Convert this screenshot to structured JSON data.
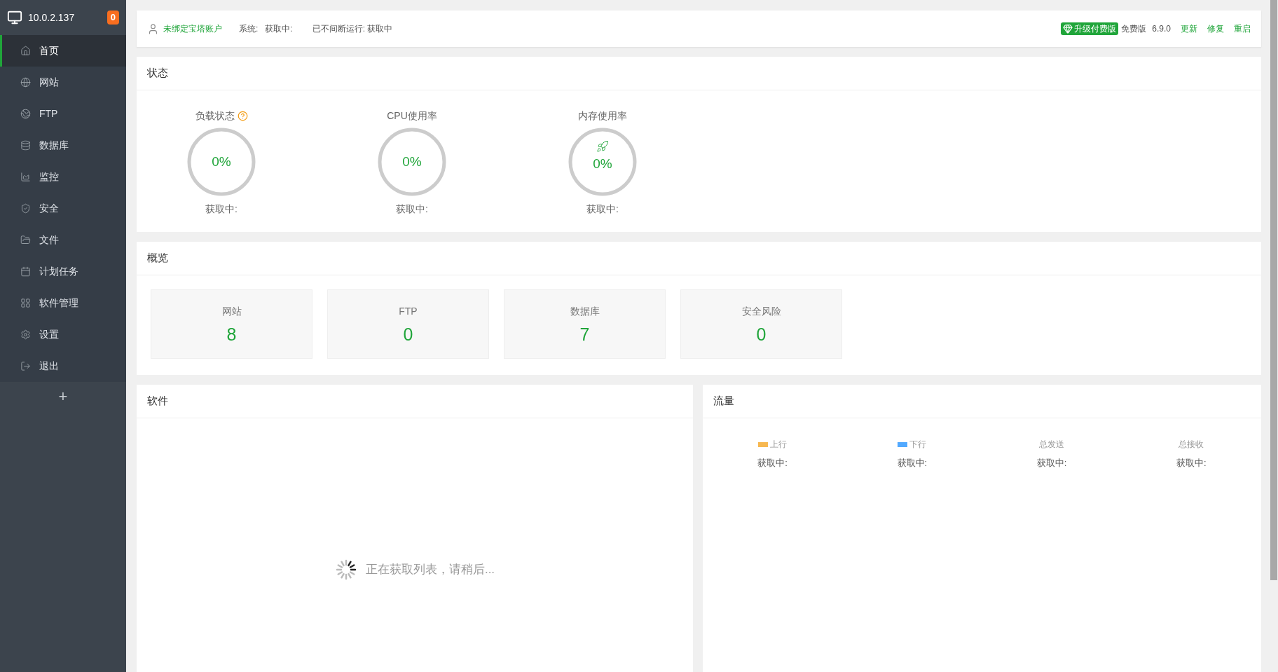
{
  "sidebar": {
    "host": "10.0.2.137",
    "badge": "0",
    "items": [
      {
        "label": "首页",
        "selected": true
      },
      {
        "label": "网站",
        "selected": false
      },
      {
        "label": "FTP",
        "selected": false
      },
      {
        "label": "数据库",
        "selected": false
      },
      {
        "label": "监控",
        "selected": false
      },
      {
        "label": "安全",
        "selected": false
      },
      {
        "label": "文件",
        "selected": false
      },
      {
        "label": "计划任务",
        "selected": false
      },
      {
        "label": "软件管理",
        "selected": false
      },
      {
        "label": "设置",
        "selected": false
      },
      {
        "label": "退出",
        "selected": false
      }
    ],
    "add": "+"
  },
  "top_bar": {
    "account": "未绑定宝塔账户",
    "system_label": "系统:",
    "system_value": "获取中:",
    "uptime": "已不间断运行: 获取中",
    "upgrade": "升级付费版",
    "edition": "免费版",
    "version": "6.9.0",
    "links": [
      "更新",
      "修复",
      "重启"
    ]
  },
  "status": {
    "title": "状态",
    "gauges": [
      {
        "label": "负载状态",
        "value": "0%",
        "caption": "获取中:"
      },
      {
        "label": "CPU使用率",
        "value": "0%",
        "caption": "获取中:"
      },
      {
        "label": "内存使用率",
        "value": "0%",
        "caption": "获取中:"
      }
    ]
  },
  "overview": {
    "title": "概览",
    "cards": [
      {
        "label": "网站",
        "value": "8"
      },
      {
        "label": "FTP",
        "value": "0"
      },
      {
        "label": "数据库",
        "value": "7"
      },
      {
        "label": "安全风险",
        "value": "0"
      }
    ]
  },
  "software": {
    "title": "软件",
    "loading": "正在获取列表，请稍后..."
  },
  "traffic": {
    "title": "流量",
    "columns": [
      {
        "label": "上行",
        "color": "#f7b851",
        "value": "获取中:"
      },
      {
        "label": "下行",
        "color": "#52a9ff",
        "value": "获取中:"
      },
      {
        "label": "总发送",
        "value": "获取中:"
      },
      {
        "label": "总接收",
        "value": "获取中:"
      }
    ]
  }
}
